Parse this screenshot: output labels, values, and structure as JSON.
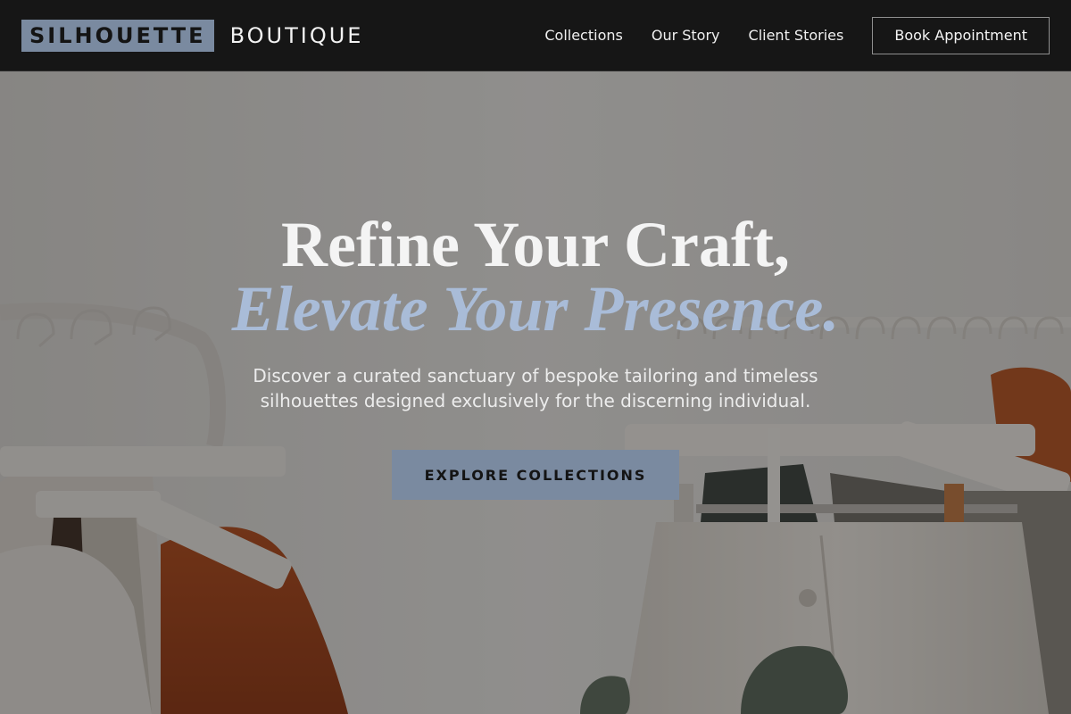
{
  "brand": {
    "primary": "SILHOUETTE",
    "secondary": "BOUTIQUE"
  },
  "nav": {
    "links": [
      "Collections",
      "Our Story",
      "Client Stories"
    ],
    "cta_label": "Book Appointment"
  },
  "hero": {
    "title_line1": "Refine Your Craft,",
    "title_line2": "Elevate Your Presence.",
    "subtitle_line1": "Discover a curated sanctuary of bespoke tailoring and timeless",
    "subtitle_line2": "silhouettes designed exclusively for the discerning individual.",
    "button_label": "EXPLORE COLLECTIONS",
    "background_image": "clothing-rack-photo"
  },
  "colors": {
    "header_bg": "#161616",
    "accent": "#7a8aa0",
    "title_highlight": "#a9bcd8",
    "text_light": "#f4f4f4"
  }
}
